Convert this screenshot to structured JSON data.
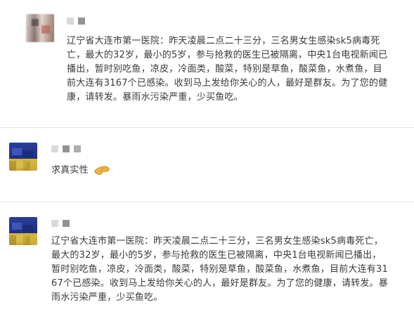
{
  "comments": [
    {
      "author_display": "",
      "avatar": "blurred-avatar",
      "text": "辽宁省大连市第一医院：昨天凌晨二点二十三分，三名男女生感染sk5病毒死亡，最大的32岁，最小的5岁，参与抢救的医生已被隔离，中央1台电视新闻已播出，暂时别吃鱼，凉皮，冷面类，酸菜，特别是草鱼，酸菜鱼，水煮鱼，目前大连有3167个已感染。收到马上发给你关心的人，最好是群友。为了您的健康，请转发。暴雨水污染严重，少买鱼吃。"
    },
    {
      "author_display": "",
      "avatar": "blurred-avatar",
      "text": "求真实性",
      "icon": "hand-pointing-icon"
    },
    {
      "author_display": "",
      "avatar": "blurred-avatar",
      "text": "辽宁省大连市第一医院：昨天凌晨二点二十三分，三名男女生感染sk5病毒死亡，最大的32岁，最小的5岁，参与抢救的医生已被隔离，中央1台电视新闻已播出，暂时别吃鱼，凉皮，冷面类，酸菜，特别是草鱼，酸菜鱼，水煮鱼，目前大连有3167个已感染。收到马上发给你关心的人，最好是群友。为了您的健康，请转发。暴雨水污染严重，少买鱼吃。"
    }
  ],
  "colors": {
    "text": "#3a3a3a",
    "divider": "#e6e6e6",
    "background": "#ffffff"
  }
}
